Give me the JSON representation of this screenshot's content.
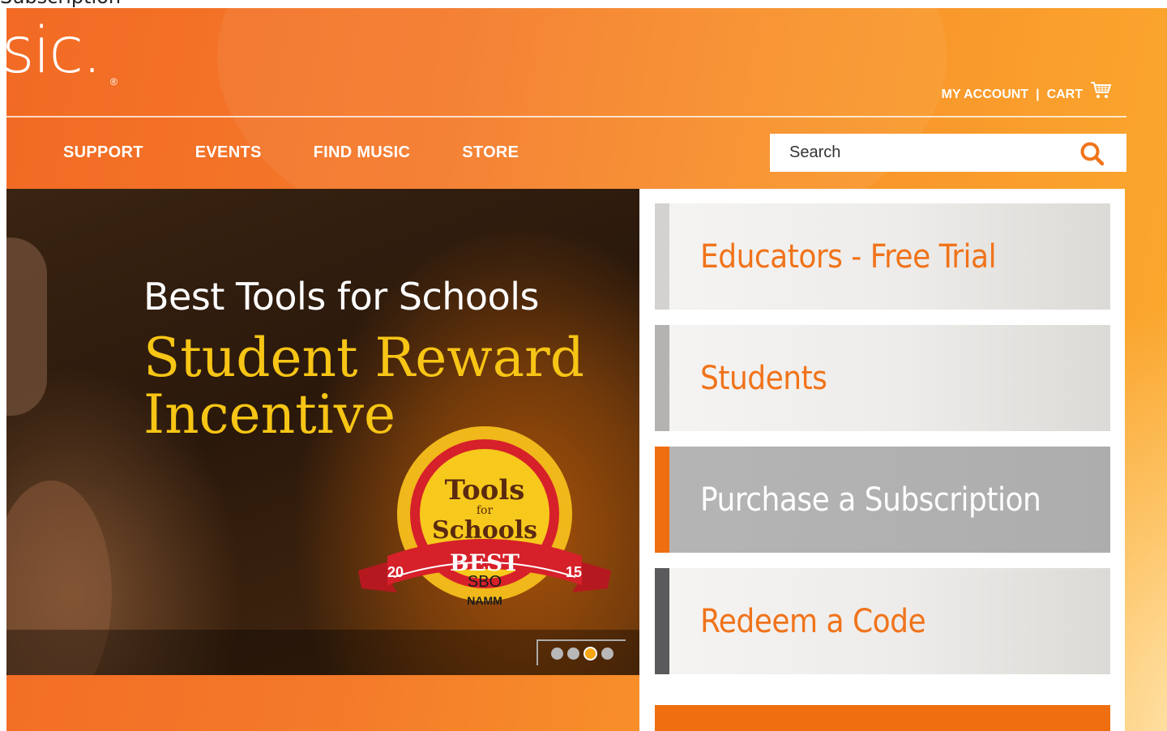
{
  "top_cut_text": "Subscription",
  "logo": {
    "text": "sic.",
    "reg": "®"
  },
  "utility_nav": {
    "my_account": "MY ACCOUNT",
    "separator": "|",
    "cart": "CART"
  },
  "main_nav": {
    "items": [
      "SUPPORT",
      "EVENTS",
      "FIND MUSIC",
      "STORE"
    ]
  },
  "search": {
    "placeholder": "Search"
  },
  "hero": {
    "line1": "Best Tools for Schools",
    "line2": "Student Reward Incentive",
    "badge": {
      "top": "Tools",
      "mid": "for",
      "bottom": "Schools",
      "ribbon": "BEST",
      "year_left": "20",
      "year_right": "15",
      "org1": "SBO",
      "org2": "NAMM"
    },
    "carousel": {
      "count": 4,
      "active_index": 2
    }
  },
  "sidebar": {
    "items": [
      {
        "label": "Educators - Free Trial",
        "bar_color": "#d3d2d0",
        "active": false
      },
      {
        "label": "Students",
        "bar_color": "#b4b3b1",
        "active": false
      },
      {
        "label": "Purchase a Subscription",
        "bar_color": "#ef6e10",
        "active": true
      },
      {
        "label": "Redeem a Code",
        "bar_color": "#5a595b",
        "active": false
      }
    ]
  },
  "colors": {
    "accent": "#f0731a",
    "brand_orange": "#f47a2a",
    "hero_gold": "#f7c515"
  }
}
